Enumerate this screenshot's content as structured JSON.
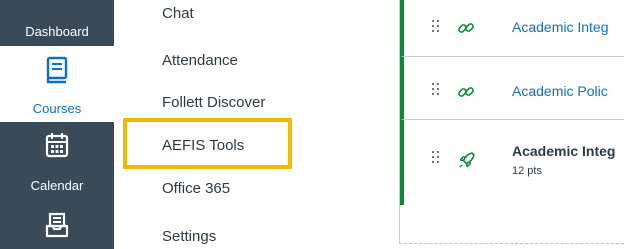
{
  "global_nav": {
    "dashboard": {
      "label": "Dashboard"
    },
    "courses": {
      "label": "Courses",
      "icon": "book-icon",
      "active": true
    },
    "calendar": {
      "label": "Calendar",
      "icon": "calendar-icon"
    },
    "inbox": {
      "icon": "inbox-icon"
    }
  },
  "course_nav": {
    "items": [
      {
        "label": "Chat"
      },
      {
        "label": "Attendance"
      },
      {
        "label": "Follett Discover"
      },
      {
        "label": "AEFIS Tools",
        "highlighted": true
      },
      {
        "label": "Office 365"
      },
      {
        "label": "Settings"
      }
    ]
  },
  "modules": {
    "items": [
      {
        "title": "Academic Integ",
        "icon": "link-icon",
        "style": "link"
      },
      {
        "title": "Academic Polic",
        "icon": "link-icon",
        "style": "link"
      },
      {
        "title": "Academic Integ",
        "icon": "assignment-rocket-icon",
        "style": "bold",
        "points": "12 pts"
      }
    ]
  },
  "colors": {
    "nav_bg": "#394b58",
    "accent_blue": "#0d6fc4",
    "highlight": "#f5b800",
    "published_green": "#0b8a34"
  }
}
